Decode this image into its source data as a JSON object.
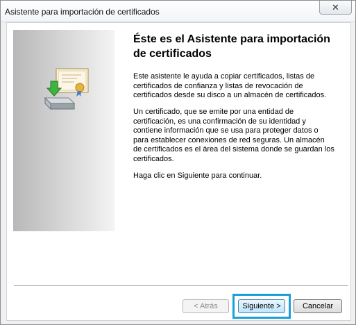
{
  "window": {
    "title": "Asistente para importación de certificados",
    "close_symbol": "✕"
  },
  "wizard": {
    "heading": "Éste es el Asistente para importación de certificados",
    "paragraph1": "Este asistente le ayuda a copiar certificados, listas de certificados de confianza y listas de revocación de certificados desde su disco a un almacén de certificados.",
    "paragraph2": "Un certificado, que se emite por una entidad de certificación, es una confirmación de su identidad y contiene información que se usa para proteger datos o para establecer conexiones de red seguras. Un almacén de certificados es el área del sistema donde se guardan los certificados.",
    "paragraph3": "Haga clic en Siguiente para continuar."
  },
  "buttons": {
    "back": "< Atrás",
    "next": "Siguiente >",
    "cancel": "Cancelar"
  },
  "icons": {
    "close": "close-icon",
    "certificate": "certificate-import-icon"
  },
  "colors": {
    "highlight": "#1a9fd9",
    "title_bar": "#f2f4f7"
  }
}
